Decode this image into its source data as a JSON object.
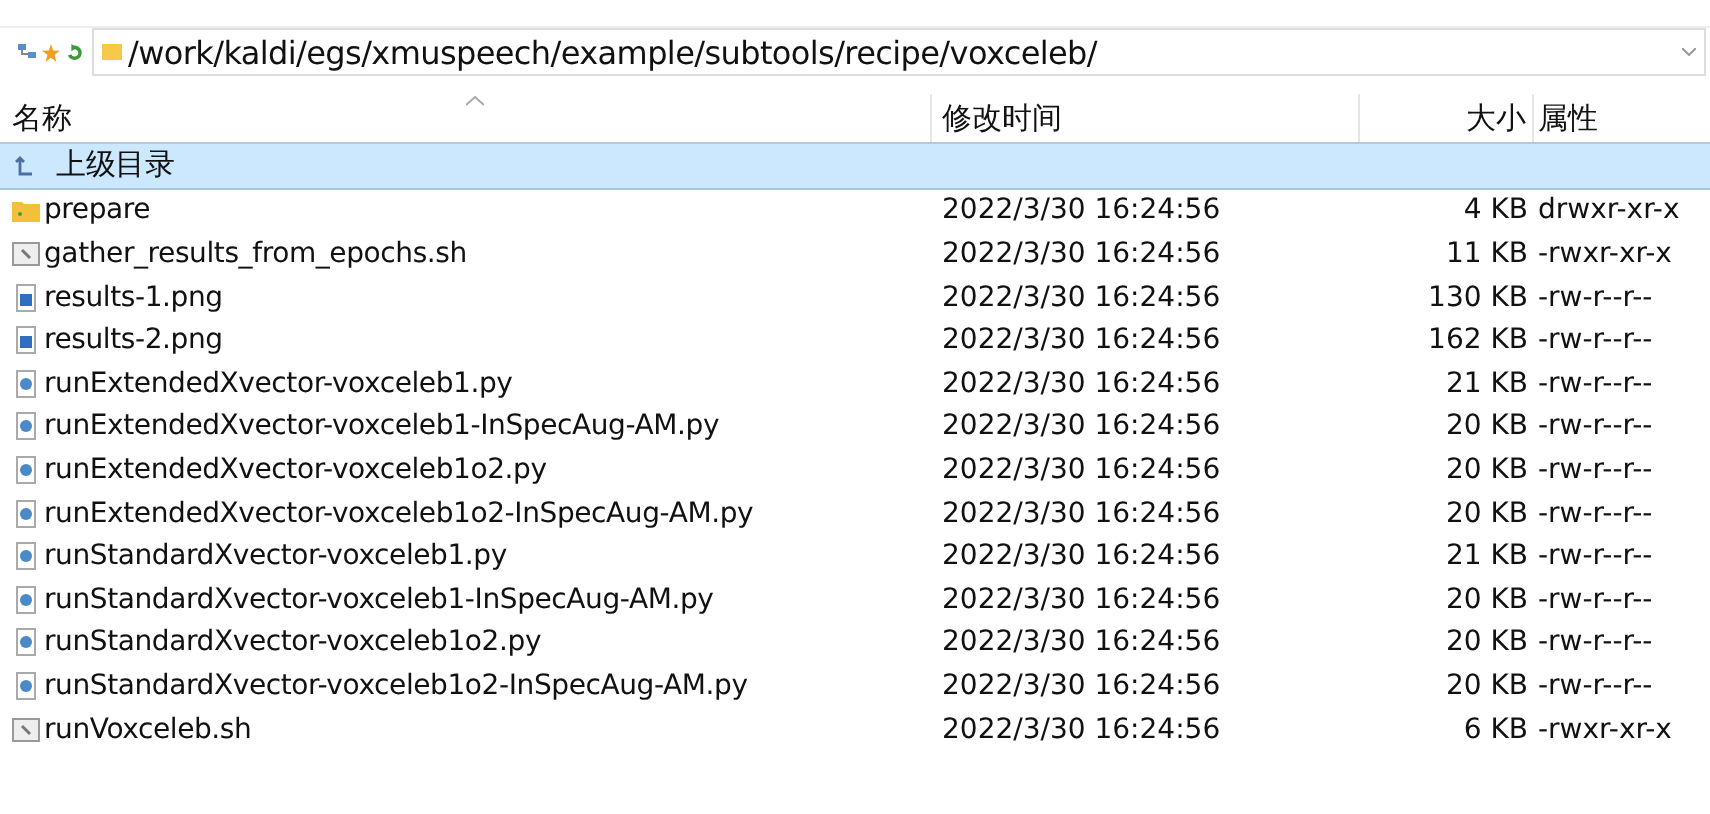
{
  "address_bar": {
    "path": "/work/kaldi/egs/xmuspeech/example/subtools/recipe/voxceleb/"
  },
  "table": {
    "columns": [
      {
        "label": "名称",
        "sorted": true
      },
      {
        "label": "修改时间",
        "sorted": false
      },
      {
        "label": "大小",
        "sorted": false
      },
      {
        "label": "属性",
        "sorted": false
      }
    ],
    "rows": [
      {
        "kind": "parent",
        "name": "上级目录",
        "selected": true
      },
      {
        "kind": "folder",
        "name": "prepare",
        "modified": "2022/3/30 16:24:56",
        "size": "4 KB",
        "attributes": "drwxr-xr-x",
        "selected": false
      },
      {
        "kind": "script",
        "name": "gather_results_from_epochs.sh",
        "modified": "2022/3/30 16:24:56",
        "size": "11 KB",
        "attributes": "-rwxr-xr-x",
        "selected": false
      },
      {
        "kind": "image",
        "name": "results-1.png",
        "modified": "2022/3/30 16:24:56",
        "size": "130 KB",
        "attributes": "-rw-r--r--",
        "selected": false
      },
      {
        "kind": "image",
        "name": "results-2.png",
        "modified": "2022/3/30 16:24:56",
        "size": "162 KB",
        "attributes": "-rw-r--r--",
        "selected": false
      },
      {
        "kind": "python",
        "name": "runExtendedXvector-voxceleb1.py",
        "modified": "2022/3/30 16:24:56",
        "size": "21 KB",
        "attributes": "-rw-r--r--",
        "selected": false
      },
      {
        "kind": "python",
        "name": "runExtendedXvector-voxceleb1-InSpecAug-AM.py",
        "modified": "2022/3/30 16:24:56",
        "size": "20 KB",
        "attributes": "-rw-r--r--",
        "selected": false
      },
      {
        "kind": "python",
        "name": "runExtendedXvector-voxceleb1o2.py",
        "modified": "2022/3/30 16:24:56",
        "size": "20 KB",
        "attributes": "-rw-r--r--",
        "selected": false
      },
      {
        "kind": "python",
        "name": "runExtendedXvector-voxceleb1o2-InSpecAug-AM.py",
        "modified": "2022/3/30 16:24:56",
        "size": "20 KB",
        "attributes": "-rw-r--r--",
        "selected": false
      },
      {
        "kind": "python",
        "name": "runStandardXvector-voxceleb1.py",
        "modified": "2022/3/30 16:24:56",
        "size": "21 KB",
        "attributes": "-rw-r--r--",
        "selected": false
      },
      {
        "kind": "python",
        "name": "runStandardXvector-voxceleb1-InSpecAug-AM.py",
        "modified": "2022/3/30 16:24:56",
        "size": "20 KB",
        "attributes": "-rw-r--r--",
        "selected": false
      },
      {
        "kind": "python",
        "name": "runStandardXvector-voxceleb1o2.py",
        "modified": "2022/3/30 16:24:56",
        "size": "20 KB",
        "attributes": "-rw-r--r--",
        "selected": false
      },
      {
        "kind": "python",
        "name": "runStandardXvector-voxceleb1o2-InSpecAug-AM.py",
        "modified": "2022/3/30 16:24:56",
        "size": "20 KB",
        "attributes": "-rw-r--r--",
        "selected": false
      },
      {
        "kind": "script",
        "name": "runVoxceleb.sh",
        "modified": "2022/3/30 16:24:56",
        "size": "6 KB",
        "attributes": "-rwxr-xr-x",
        "selected": false
      }
    ]
  }
}
